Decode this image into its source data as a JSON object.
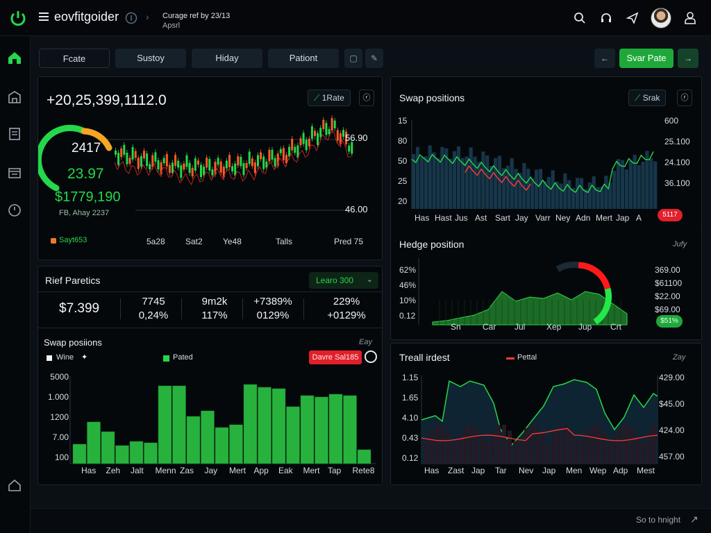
{
  "topbar": {
    "brand": "eovfitgoider",
    "title_line1": "Curage ref by 23/13",
    "title_line2": "Apsrl"
  },
  "tabs": [
    "Fcate",
    "Sustoy",
    "Hiday",
    "Pationt"
  ],
  "actions": {
    "swap_rate": "Svar Pate"
  },
  "main_chart": {
    "big_value": "+20,25,399,1112.0",
    "rate_chip": "1Rate",
    "gauge_val": "2417",
    "green_val": "23.97",
    "price": "$1779,190",
    "date": "FB, Ahay 2237",
    "right_high": "56.90",
    "right_low": "46.00",
    "legend": "Sayt653",
    "xlabels": [
      "5a28",
      "Sat2",
      "Ye48",
      "Talls",
      "Pred 75"
    ]
  },
  "stats": {
    "title": "Rief Paretics",
    "learn_btn": "Learo 300",
    "main_val": "$7.399",
    "cols": [
      {
        "top": "7745",
        "bot": "0,24%"
      },
      {
        "top": "9m2k",
        "bot": "117%"
      },
      {
        "top": "+7389%",
        "bot": "0129%"
      },
      {
        "top": "229%",
        "bot": "+0129%"
      }
    ]
  },
  "swap_bottom": {
    "title": "Swap posiions",
    "corner": "Eay",
    "legend1": "Wine",
    "legend2": "Pated",
    "button": "Davre Sal185",
    "yticks": [
      "5000",
      "1.000",
      "1200",
      "7.00",
      "100"
    ],
    "xlabels": [
      "Has",
      "Zeh",
      "Jalt",
      "Menn",
      "Zas",
      "Jay",
      "Mert",
      "App",
      "Eak",
      "Mert",
      "Tap",
      "Rete8"
    ]
  },
  "swap_right": {
    "title": "Swap positions",
    "chip": "Srak",
    "left_ticks": [
      "15",
      "80",
      "50",
      "25",
      "20"
    ],
    "right_ticks": [
      "600",
      "25.100",
      "24.100",
      "36.100"
    ],
    "badge": "5117",
    "xlabels": [
      "Has",
      "Hast",
      "Jus",
      "Ast",
      "Sart",
      "Jay",
      "Varr",
      "Ney",
      "Adn",
      "Mert",
      "Jap",
      "A"
    ]
  },
  "hedge": {
    "title": "Hedge position",
    "corner": "Jufy",
    "left_ticks": [
      "62%",
      "46%",
      "10%",
      "0.12"
    ],
    "right_ticks": [
      "369.00",
      "$61100",
      "$22.00",
      "$69.00"
    ],
    "badge": "$51%",
    "xlabels": [
      "Sn",
      "Car",
      "Jul",
      "Xep",
      "Jup",
      "Crt"
    ]
  },
  "trend": {
    "title": "Treall irdest",
    "legend": "Pettal",
    "corner": "Zay",
    "left_ticks": [
      "1.15",
      "1.65",
      "4.10",
      "0.43",
      "0.12"
    ],
    "right_ticks": [
      "429.00",
      "$45.00",
      "424.00",
      "457.00"
    ],
    "xlabels": [
      "Has",
      "Zast",
      "Jap",
      "Tar",
      "Nev",
      "Jap",
      "Men",
      "Wep",
      "Adp",
      "Mest"
    ]
  },
  "footer": {
    "text": "So to hnight"
  },
  "colors": {
    "green": "#23d84a",
    "red": "#ff3b3b",
    "orange": "#f5a623",
    "bg": "#05080b"
  }
}
